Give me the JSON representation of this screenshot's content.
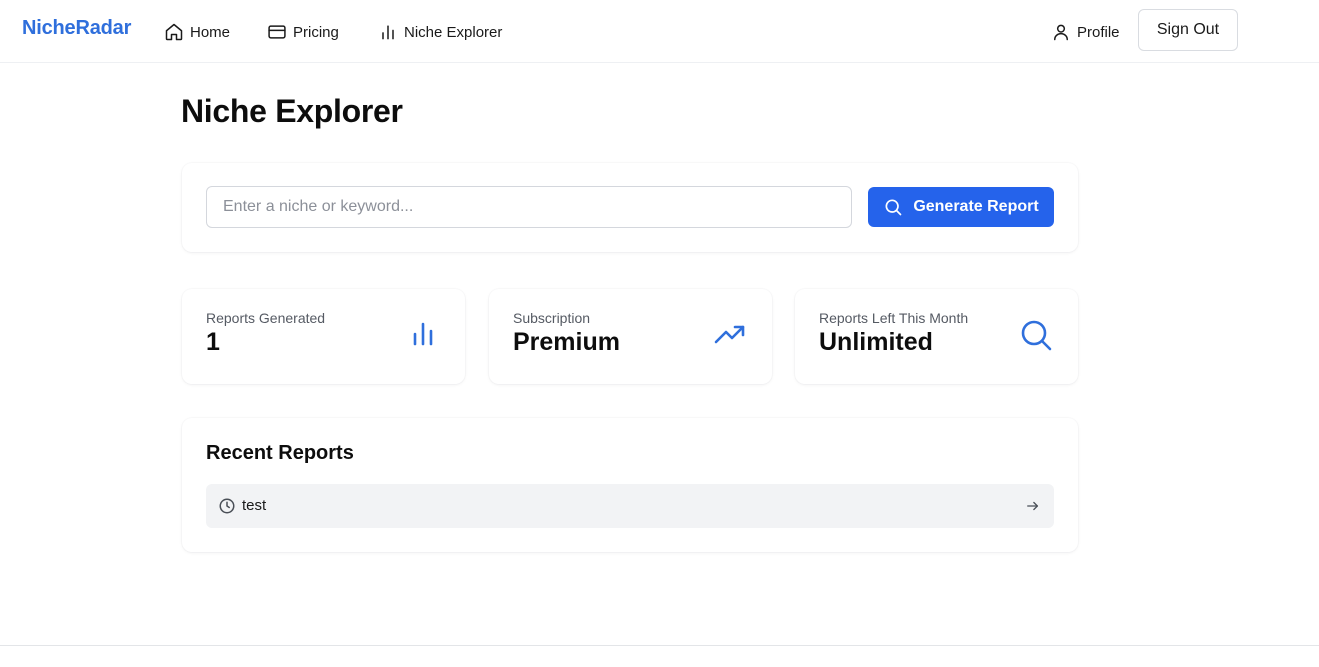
{
  "nav": {
    "brand": "NicheRadar",
    "links": [
      {
        "label": "Home",
        "icon": "home-icon"
      },
      {
        "label": "Pricing",
        "icon": "credit-card-icon"
      },
      {
        "label": "Niche Explorer",
        "icon": "bar-chart-icon"
      }
    ],
    "profile_label": "Profile",
    "profile_icon": "user-icon",
    "signout_label": "Sign Out"
  },
  "page": {
    "title": "Niche Explorer"
  },
  "search": {
    "placeholder": "Enter a niche or keyword...",
    "value": "",
    "button_label": "Generate Report",
    "button_icon": "search-icon"
  },
  "stats": [
    {
      "label": "Reports Generated",
      "value": "1",
      "icon": "bar-chart-icon"
    },
    {
      "label": "Subscription",
      "value": "Premium",
      "icon": "trending-up-icon"
    },
    {
      "label": "Reports Left This Month",
      "value": "Unlimited",
      "icon": "search-icon"
    }
  ],
  "recent": {
    "title": "Recent Reports",
    "items": [
      {
        "label": "test",
        "icon": "clock-icon",
        "action_icon": "arrow-right-icon"
      }
    ]
  },
  "colors": {
    "brand": "#2f6fdc",
    "primary": "#2563eb",
    "row_bg": "#f2f3f5",
    "muted_text": "#555a63"
  }
}
